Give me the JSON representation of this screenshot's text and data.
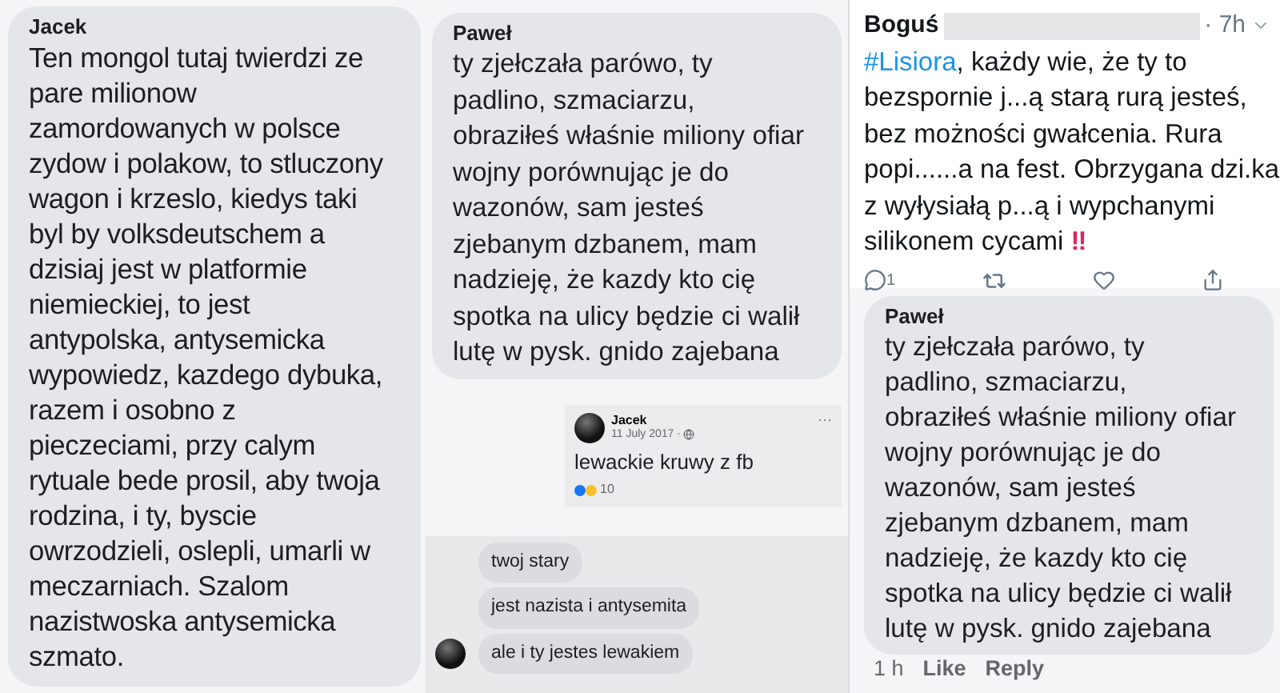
{
  "left_comment": {
    "author": "Jacek",
    "text": "Ten mongol tutaj twierdzi ze\npare milionow\nzamordowanych w polsce\nzydow i polakow, to stluczony\nwagon i krzeslo, kiedys taki\nbyl by volksdeutschem a\ndzisiaj jest w platformie\nniemieckiej, to jest\nantypolska, antysemicka\nwypowiedz, kazdego dybuka,\nrazem i osobno z\npieczeciami, przy calym\nrytuale bede prosil, aby twoja\nrodzina, i ty, byscie\nowrzodzieli, oslepli, umarli w\nmeczarniach. Szalom\nnazistwoska antysemicka\nszmato."
  },
  "middle_comment": {
    "author": "Paweł",
    "text": "ty zjełczała parówo, ty\npadlino, szmaciarzu,\nobraziłeś właśnie miliony ofiar\nwojny porównując je do\nwazonów, sam jesteś\nzjebanym dzbanem, mam\nnadzieję, że kazdy kto cię\nspotka na ulicy będzie ci walił\nlutę w pysk. gnido zajebana"
  },
  "facebook_post": {
    "author": "Jacek",
    "date": "11 July 2017 · ",
    "menu": "···",
    "text": "lewackie kruwy z fb",
    "reaction_count": "10"
  },
  "messenger": {
    "messages": [
      {
        "text": "twoj stary",
        "avatar": false
      },
      {
        "text": "jest nazista i antysemita",
        "avatar": false
      },
      {
        "text": "ale i ty jestes lewakiem",
        "avatar": true
      }
    ]
  },
  "tweet": {
    "author": "Boguś",
    "time": "· 7h",
    "hashtag": "#Lisiora",
    "text": ", każdy wie, że ty to bezspornie j...ą starą rurą jesteś, bez możności gwałcenia. Rura popi......a na fest. Obrzygana dzi.ka z wyłysiałą p...ą i wypchanymi silikonem cycami ",
    "emphasis": "‼",
    "reply_count": "1"
  },
  "right_comment": {
    "author": "Paweł",
    "text": "ty zjełczała parówo, ty\npadlino, szmaciarzu,\nobraziłeś właśnie miliony ofiar\nwojny porównując je do\nwazonów, sam jesteś\nzjebanym dzbanem, mam\nnadzieję, że kazdy kto cię\nspotka na ulicy będzie ci walił\nlutę w pysk. gnido zajebana",
    "time": "1 h",
    "actions": [
      "Like",
      "Reply"
    ]
  }
}
